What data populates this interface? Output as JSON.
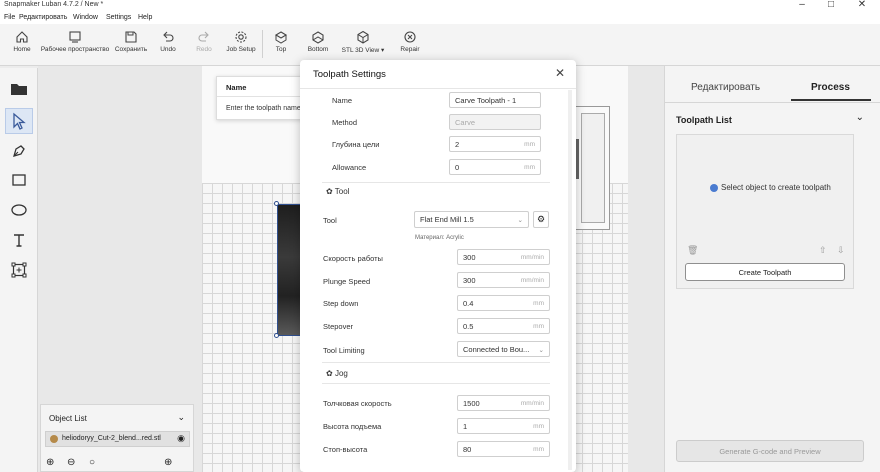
{
  "window": {
    "title": "Snapmaker Luban 4.7.2 / New *"
  },
  "menu": [
    "File",
    "Редактировать",
    "Window",
    "Settings",
    "Help"
  ],
  "toolbar": {
    "home": "Home",
    "workspace": "Рабочее пространство",
    "save": "Сохранить",
    "undo": "Undo",
    "redo": "Redo",
    "job_setup": "Job Setup",
    "top": "Top",
    "bottom": "Bottom",
    "stl_view": "STL 3D View",
    "repair": "Repair"
  },
  "tooltip": {
    "title": "Name",
    "body": "Enter the toolpath name."
  },
  "object_list": {
    "title": "Object List",
    "item": "heliodoryy_Cut-2_blend...red.stl"
  },
  "dialog": {
    "title": "Toolpath Settings",
    "name_label": "Name",
    "name_value": "Carve Toolpath - 1",
    "method_label": "Method",
    "method_value": "Carve",
    "depth_label": "Глубина цели",
    "depth_value": "2",
    "depth_unit": "mm",
    "allowance_label": "Allowance",
    "allowance_value": "0",
    "allowance_unit": "mm",
    "tool_section": "Tool",
    "tool_label": "Tool",
    "tool_value": "Flat End Mill 1.5",
    "material_note": "Материал: Acrylic",
    "work_speed_label": "Скорость работы",
    "work_speed_value": "300",
    "work_speed_unit": "mm/min",
    "plunge_label": "Plunge Speed",
    "plunge_value": "300",
    "plunge_unit": "mm/min",
    "stepdown_label": "Step down",
    "stepdown_value": "0.4",
    "stepdown_unit": "mm",
    "stepover_label": "Stepover",
    "stepover_value": "0.5",
    "stepover_unit": "mm",
    "limiting_label": "Tool Limiting",
    "limiting_value": "Connected to Bou...",
    "jog_section": "Jog",
    "jog_speed_label": "Толчковая скорость",
    "jog_speed_value": "1500",
    "jog_speed_unit": "mm/min",
    "lift_label": "Высота подъема",
    "lift_value": "1",
    "lift_unit": "mm",
    "stop_label": "Стоп-высота",
    "stop_value": "80",
    "stop_unit": "mm"
  },
  "right_panel": {
    "tab_edit": "Редактировать",
    "tab_process": "Process",
    "toolpath_list": "Toolpath List",
    "hint": "Select object to create toolpath",
    "create_btn": "Create Toolpath",
    "generate_btn": "Generate G-code and Preview"
  },
  "colors": {
    "accent": "#4a7bd0",
    "selection": "#2f4f8f"
  }
}
